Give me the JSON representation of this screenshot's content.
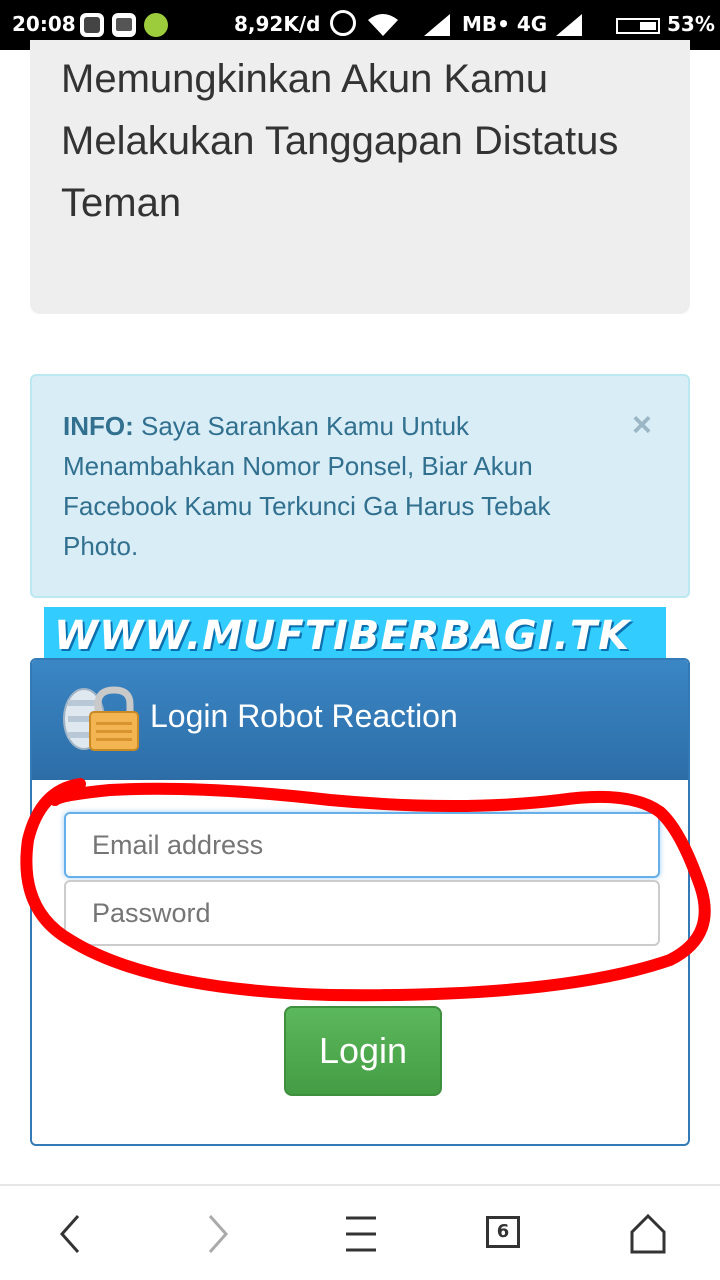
{
  "status_bar": {
    "time": "20:08",
    "speed": "8,92K/d",
    "carrier": "MB• 4G",
    "battery": "53%",
    "icons": [
      "bbm-icon",
      "message-icon",
      "android-icon",
      "alarm-icon",
      "wifi-icon",
      "signal-icon",
      "battery-icon"
    ]
  },
  "hero": {
    "text": "Memungkinkan Akun Kamu Melakukan Tanggapan Distatus Teman"
  },
  "alert": {
    "label": "INFO:",
    "message": " Saya Sarankan Kamu Untuk Menambahkan Nomor Ponsel, Biar Akun Facebook Kamu Terkunci Ga Harus Tebak Photo.",
    "close": "×"
  },
  "watermark": {
    "text": "WWW.MUFTIBERBAGI.TK"
  },
  "login_panel": {
    "title": "Login Robot Reaction",
    "email_placeholder": "Email address",
    "password_placeholder": "Password",
    "button_label": "Login"
  },
  "bottom_nav": {
    "tab_count": "6",
    "items": [
      "back-icon",
      "forward-icon",
      "menu-icon",
      "tabs-icon",
      "home-icon"
    ]
  },
  "colors": {
    "alert_bg": "#d9edf7",
    "alert_text": "#31708f",
    "panel_head": "#337ab7",
    "login_green": "#5cb85c",
    "annotation_red": "#ff0000"
  }
}
